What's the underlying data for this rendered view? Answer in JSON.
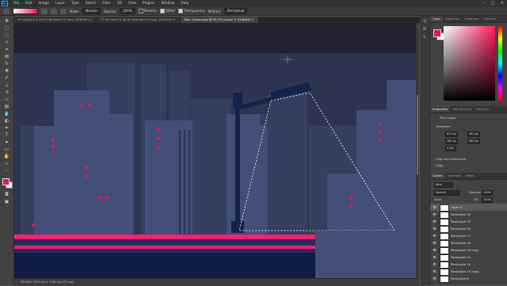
{
  "menubar": {
    "items": [
      "File",
      "Edit",
      "Image",
      "Layer",
      "Type",
      "Select",
      "Filter",
      "3D",
      "View",
      "Plugins",
      "Window",
      "Help"
    ]
  },
  "window_controls": [
    "–",
    "□",
    "×"
  ],
  "options": {
    "mode_label": "Mode:",
    "mode_value": "Normal",
    "opacity_label": "Opacity:",
    "opacity_value": "100%",
    "reverse_label": "Reverse",
    "dither_label": "Dither",
    "transparency_label": "Transparency",
    "method_label": "Method:",
    "method_value": "Perceptual"
  },
  "tabs": [
    {
      "label": "P1 Artwork & Ad R1 Bedroom R copy, RGB/8#) ×",
      "active": false
    },
    {
      "label": "P1 Art work & Ad R1 Bedroom R copy, RGB/8#) ×",
      "active": false
    },
    {
      "label": "Mini Cosmo.psd @ 95.7% (Layer 5, RGB/8#) ×",
      "active": true
    }
  ],
  "status_text": "95.66%   1920 px x 1080 px (72 ppi)",
  "color_panel": {
    "tabs": [
      "Color",
      "Swatches",
      "Gradients",
      "Patterns"
    ],
    "fg": "#e8145f",
    "bg": "#ffffff"
  },
  "properties_panel": {
    "tabs": [
      "Properties",
      "Adjustments",
      "Libraries"
    ],
    "kind": "Pixel Layer",
    "transform_label": "Transform",
    "w": "615 px",
    "h": "381 px",
    "x": "381 px",
    "y": "283 px",
    "angle": "0.00°",
    "align_label": "Align and Distribute",
    "align_sub": "Align:"
  },
  "layers_panel": {
    "tabs": [
      "Layers",
      "Channels",
      "Paths"
    ],
    "kind_label": "Kind",
    "blend_mode": "Normal",
    "opacity_label": "Opacity:",
    "opacity_value": "100%",
    "lock_label": "Lock:",
    "fill_label": "Fill:",
    "fill_value": "100%",
    "layers": [
      {
        "name": "Layer 5",
        "selected": true
      },
      {
        "name": "Rectangle 20",
        "selected": false
      },
      {
        "name": "Rectangle 19",
        "selected": false
      },
      {
        "name": "Rectangle 18",
        "selected": false
      },
      {
        "name": "Rectangle 17",
        "selected": false
      },
      {
        "name": "Rectangle 16",
        "selected": false
      },
      {
        "name": "Rectangle 16 copy",
        "selected": false
      },
      {
        "name": "Rectangle 15",
        "selected": false
      },
      {
        "name": "Rectangle 14",
        "selected": false
      },
      {
        "name": "Rectangle 14 copy",
        "selected": false
      },
      {
        "name": "Rectangle 8",
        "selected": false
      }
    ]
  },
  "art_colors": {
    "sky_top": "#222130",
    "sky": "#2e3551",
    "bg_buildings": "#363f5f",
    "fg_buildings": "#434f78",
    "lamp": "#14234a",
    "windows": "#e8145f",
    "stripe": "#ff1e6e",
    "ground": "#0f1c45"
  }
}
